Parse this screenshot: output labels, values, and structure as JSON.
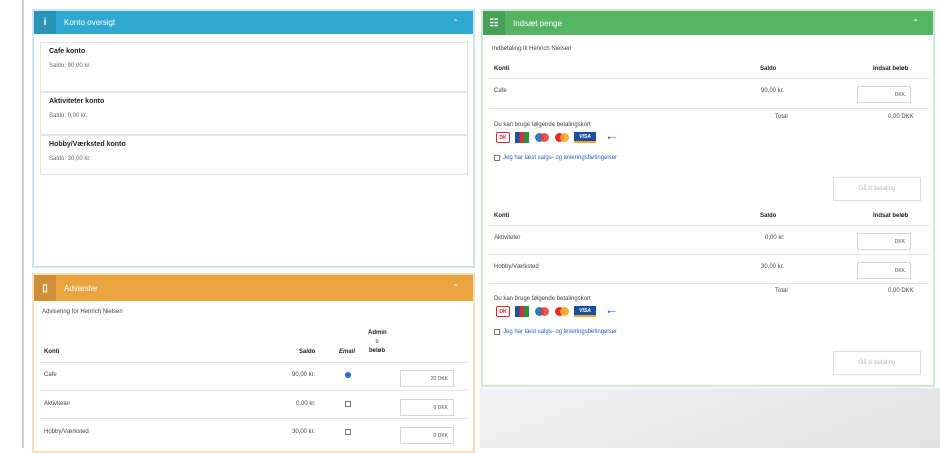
{
  "konto": {
    "title": "Konto oversigt",
    "collapse_icon": "chevron-up-icon",
    "items": [
      {
        "title": "Cafe konto",
        "saldo": "Saldo: 90,00 kr."
      },
      {
        "title": "Aktiviteter konto",
        "saldo": "Saldo: 0,00 kr."
      },
      {
        "title": "Hobby/Værksted konto",
        "saldo": "Saldo: 30,00 kr."
      }
    ]
  },
  "advarsler": {
    "title": "Advarsler",
    "subtitle": "Advisering for Henrich Nielsen",
    "headers": {
      "konti": "Konti",
      "saldo": "Saldo",
      "email": "Email",
      "admin": "Admin ≡ beløb"
    },
    "rows": [
      {
        "konto": "Cafe",
        "saldo": "90,00 kr.",
        "email": true,
        "beloeb": "20 DKK"
      },
      {
        "konto": "Aktiviteter",
        "saldo": "0,00 kr.",
        "email": false,
        "beloeb": "0 DKK"
      },
      {
        "konto": "Hobby/Værksted",
        "saldo": "30,00 kr.",
        "email": false,
        "beloeb": "0 DKK"
      }
    ]
  },
  "indsat": {
    "title": "Indsæt penge",
    "subtitle": "Indbetaling til Henrich Nielsen",
    "headers": {
      "konti": "Konti",
      "saldo": "Saldo",
      "indsat": "Indsat beløb"
    },
    "section1": {
      "rows": [
        {
          "konto": "Cafe",
          "saldo": "90,00 kr.",
          "beloeb": "DKK"
        }
      ],
      "cards_text": "Du kan bruge følgende betalingskort",
      "total_label": "Total",
      "total_value": "0,00 DKK",
      "terms": "Jeg har læst salgs- og leveringsbetingelser",
      "button": "Gå til betaling"
    },
    "section2": {
      "rows": [
        {
          "konto": "Aktiviteter",
          "saldo": "0,00 kr.",
          "beloeb": "DKK"
        },
        {
          "konto": "Hobby/Værksted",
          "saldo": "30,00 kr.",
          "beloeb": "DKK"
        }
      ],
      "cards_text": "Du kan bruge følgende betalingskort",
      "total_label": "Total",
      "total_value": "0,00 DKK",
      "terms": "Jeg har læst salgs- og leveringsbetingelser",
      "button": "Gå til betaling"
    }
  },
  "colors": {
    "konto_header": "#2fa9d2",
    "advarsler_header": "#eaa440",
    "indsat_header": "#55b565"
  }
}
